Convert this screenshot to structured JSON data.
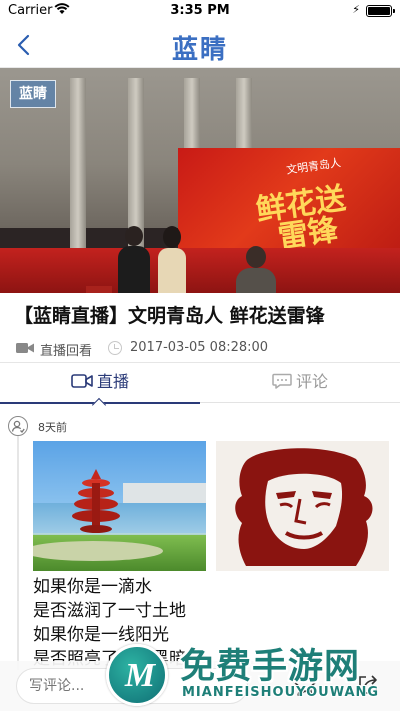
{
  "status_bar": {
    "carrier": "Carrier",
    "time": "3:35 PM"
  },
  "nav": {
    "title_part1": "蓝",
    "title_part2": "睛",
    "back_icon": "chevron-left-icon"
  },
  "video": {
    "watermark": "蓝睛",
    "backdrop_title_line1": "鲜花送",
    "backdrop_title_line2": "雷锋",
    "backdrop_subtitle": "文明青岛人"
  },
  "article": {
    "title": "【蓝睛直播】文明青岛人 鲜花送雷锋",
    "type": "直播回看",
    "datetime": "2017-03-05 08:28:00"
  },
  "tabs": [
    {
      "label": "直播",
      "active": true
    },
    {
      "label": "评论",
      "active": false
    }
  ],
  "feed": {
    "time_ago": "8天前",
    "poem": [
      "如果你是一滴水",
      "是否滋润了一寸土地",
      "如果你是一线阳光",
      "是否照亮了一分黑暗"
    ]
  },
  "bottom_bar": {
    "input_placeholder": "写评论..."
  },
  "watermark_site": {
    "cn": "免费手游网",
    "en": "MIANFEISHOUYOUWANG",
    "logo_letter": "M"
  },
  "colors": {
    "accent": "#2a3a78",
    "brand_blue": "#3b6fc2",
    "watermark_green": "#1e7f78"
  }
}
